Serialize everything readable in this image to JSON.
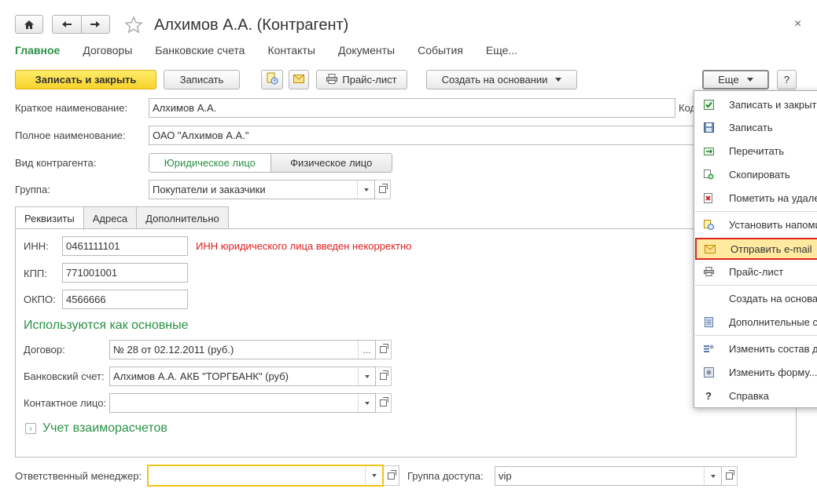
{
  "window": {
    "title": "Алхимов А.А. (Контрагент)",
    "close": "×"
  },
  "top_tabs": [
    "Главное",
    "Договоры",
    "Банковские счета",
    "Контакты",
    "Документы",
    "События",
    "Еще..."
  ],
  "toolbar": {
    "save_close": "Записать и закрыть",
    "save": "Записать",
    "price_list": "Прайс-лист",
    "create_based": "Создать на основании",
    "more": "Еще",
    "help": "?"
  },
  "form": {
    "short_name_label": "Краткое наименование:",
    "short_name_value": "Алхимов А.А.",
    "code_label": "Код",
    "full_name_label": "Полное наименование:",
    "full_name_value": "ОАО \"Алхимов А.А.\"",
    "kind_label": "Вид контрагента:",
    "kind_options": [
      "Юридическое лицо",
      "Физическое лицо"
    ],
    "kind_selected": "Юридическое лицо",
    "group_label": "Группа:",
    "group_value": "Покупатели и заказчики"
  },
  "inner_tabs": [
    "Реквизиты",
    "Адреса",
    "Дополнительно"
  ],
  "requisites": {
    "inn_label": "ИНН:",
    "inn_value": "0461111101",
    "inn_error": "ИНН юридического лица введен некорректно",
    "kpp_label": "КПП:",
    "kpp_value": "771001001",
    "okpo_label": "ОКПО:",
    "okpo_value": "4566666",
    "main_section": "Используются как основные",
    "contract_label": "Договор:",
    "contract_value": "№ 28 от 02.12.2011 (руб.)",
    "bank_label": "Банковский счет:",
    "bank_value": "Алхимов А.А. АКБ \"ТОРГБАНК\" (руб)",
    "contact_label": "Контактное лицо:",
    "contact_value": "",
    "settlements": "Учет взаиморасчетов"
  },
  "bottom": {
    "manager_label": "Ответственный менеджер:",
    "manager_value": "",
    "access_label": "Группа доступа:",
    "access_value": "vip"
  },
  "menu": {
    "items": [
      {
        "label": "Записать и закрыть",
        "icon": "check-doc-icon"
      },
      {
        "label": "Записать",
        "icon": "save-disk-icon"
      },
      {
        "label": "Перечитать",
        "icon": "reload-icon"
      },
      {
        "label": "Скопировать",
        "icon": "copy-add-icon"
      },
      {
        "label": "Пометить на удаление",
        "icon": "delete-mark-icon"
      },
      {
        "label": "Установить напоминание",
        "icon": "reminder-icon"
      },
      {
        "label": "Отправить e-mail",
        "icon": "envelope-icon"
      },
      {
        "label": "Прайс-лист",
        "icon": "printer-icon"
      },
      {
        "label": "Создать на основании",
        "icon": ""
      },
      {
        "label": "Дополнительные сведения",
        "icon": "document-list-icon"
      },
      {
        "label": "Изменить состав добавлений",
        "icon": "list-settings-icon"
      },
      {
        "label": "Изменить форму...",
        "icon": "form-settings-icon"
      },
      {
        "label": "Справка",
        "icon": "question-icon"
      }
    ],
    "highlighted": "Отправить e-mail"
  },
  "colors": {
    "accent_green": "#2a9145",
    "primary_button": "#f7d22a",
    "error_red": "#e01d1d",
    "highlight_border": "#e3201b"
  }
}
